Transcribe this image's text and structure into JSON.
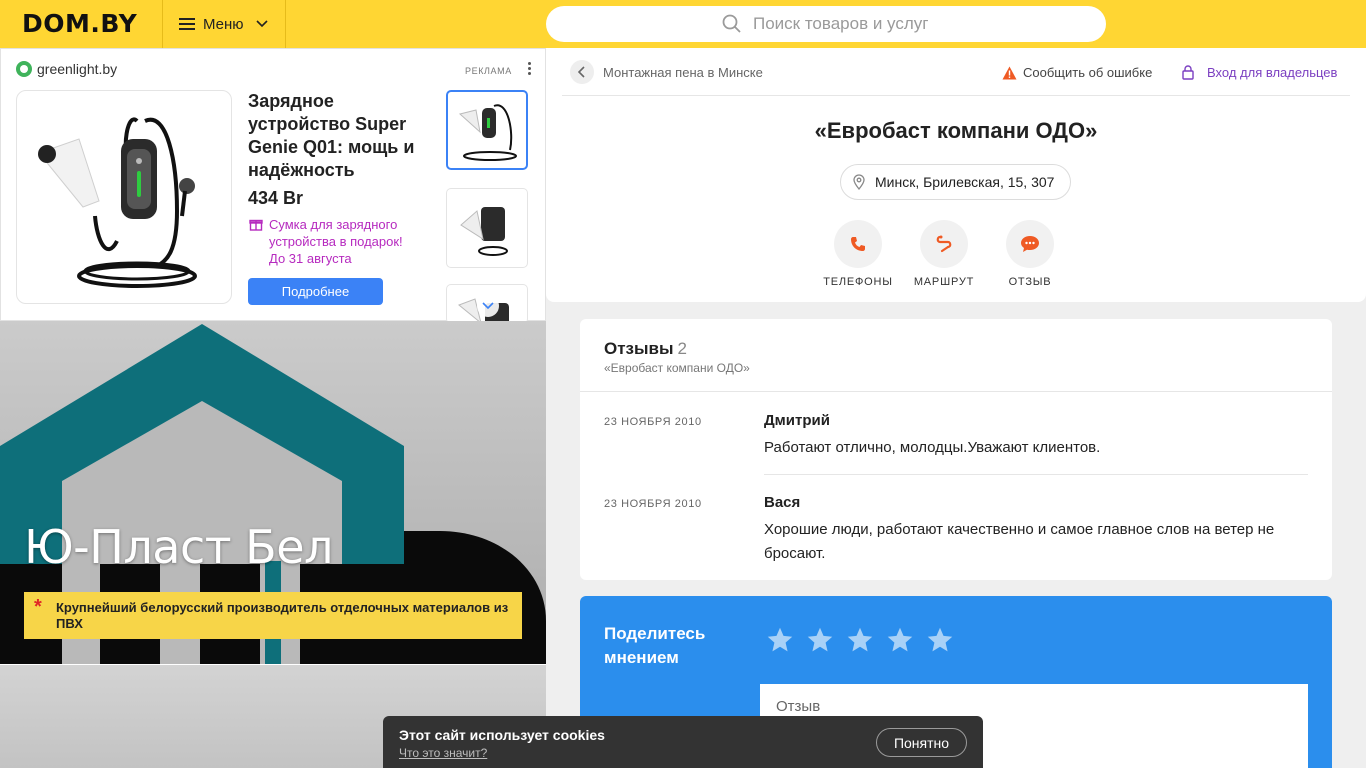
{
  "header": {
    "logo": "DOM.BY",
    "menu_label": "Меню",
    "search_placeholder": "Поиск товаров и услуг",
    "bg_color": "#ffd633"
  },
  "ad": {
    "brand": "greenlight.by",
    "tag": "РЕКЛАМА",
    "title": "Зарядное устройство Super Genie Q01: мощь и надёжность",
    "price": "434 Br",
    "gift": "Сумка для зарядного устройства в подарок! До 31 августа",
    "button": "Подробнее",
    "button_color": "#3b82f6",
    "gift_color": "#b62abf"
  },
  "banner": {
    "title": "Ю-Пласт Бел",
    "note": "Крупнейший белорусский производитель отделочных материалов из ПВХ"
  },
  "company": {
    "breadcrumb": "Монтажная пена в Минске",
    "report": "Сообщить об ошибке",
    "owner_login": "Вход для владельцев",
    "name": "«Евробаст компани ОДО»",
    "address": "Минск, Брилевская, 15, 307",
    "actions": [
      {
        "label": "ТЕЛЕФОНЫ",
        "icon": "phone-icon"
      },
      {
        "label": "МАРШРУТ",
        "icon": "route-icon"
      },
      {
        "label": "ОТЗЫВ",
        "icon": "chat-icon"
      }
    ],
    "accent_color": "#ef5a24"
  },
  "reviews": {
    "title": "Отзывы",
    "count": "2",
    "subtitle": "«Евробаст компани ОДО»",
    "items": [
      {
        "date": "23 НОЯБРЯ 2010",
        "author": "Дмитрий",
        "text": "Работают отлично, молодцы.Уважают клиентов."
      },
      {
        "date": "23 НОЯБРЯ 2010",
        "author": "Вася",
        "text": "Хорошие люди, работают качественно и самое главное слов на ветер не бросают."
      }
    ]
  },
  "share": {
    "title": "Поделитесь мнением",
    "input_placeholder": "Отзыв",
    "star_count": 5,
    "bg_color": "#2b8eed"
  },
  "cookie": {
    "title": "Этот сайт использует cookies",
    "link": "Что это значит?",
    "button": "Понятно"
  }
}
